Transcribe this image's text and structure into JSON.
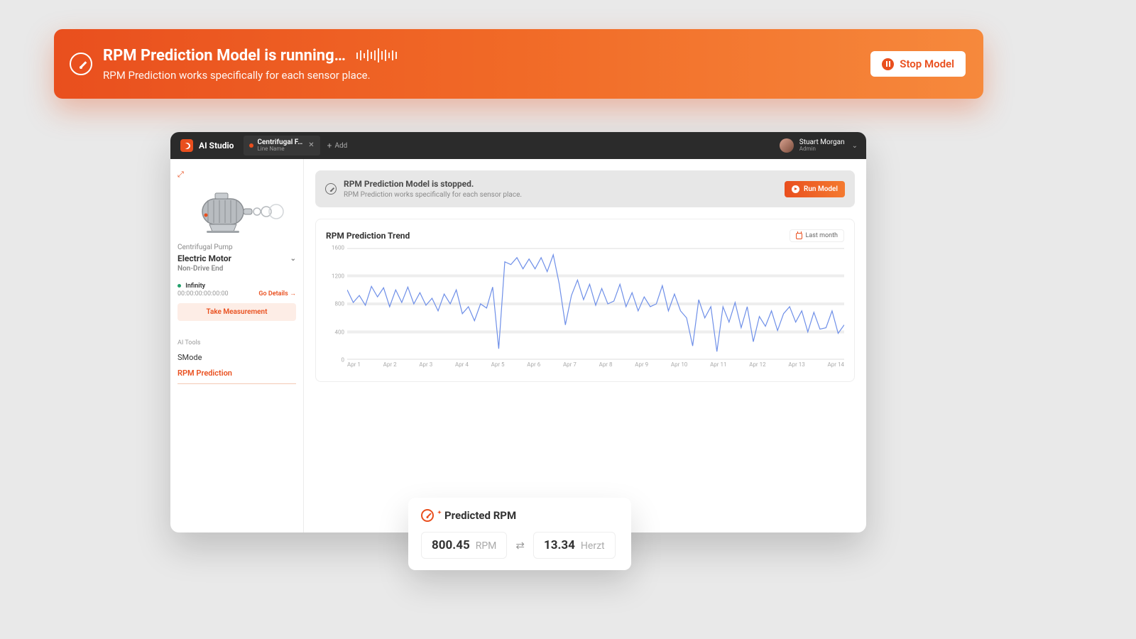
{
  "banner": {
    "title": "RPM Prediction Model is running…",
    "subtitle": "RPM Prediction works specifically for each sensor place.",
    "stop_label": "Stop Model"
  },
  "titlebar": {
    "app_name": "AI Studio",
    "tab": {
      "name": "Centrifugal F…",
      "subline": "Line Name"
    },
    "add_label": "Add",
    "user": {
      "name": "Stuart Morgan",
      "role": "Admin"
    }
  },
  "sidebar": {
    "category": "Centrifugal Pump",
    "asset": "Electric Motor",
    "position": "Non-Drive End",
    "status": "Infinity",
    "time": "00:00:00:00:00:00",
    "go_details": "Go Details →",
    "take_measurement": "Take Measurement",
    "ai_tools_label": "AI Tools",
    "tools": [
      "SMode",
      "RPM Prediction"
    ]
  },
  "stopped_banner": {
    "title": "RPM Prediction Model is stopped.",
    "subtitle": "RPM Prediction works specifically for each sensor place.",
    "run_label": "Run Model"
  },
  "chart": {
    "title": "RPM Prediction Trend",
    "range_label": "Last month"
  },
  "chart_data": {
    "type": "line",
    "title": "RPM Prediction Trend",
    "xlabel": "",
    "ylabel": "",
    "ylim": [
      0,
      1600
    ],
    "y_ticks": [
      0,
      400,
      800,
      1200,
      1600
    ],
    "x_categories": [
      "Apr 1",
      "Apr 2",
      "Apr 3",
      "Apr 4",
      "Apr 5",
      "Apr 6",
      "Apr 7",
      "Apr 8",
      "Apr 9",
      "Apr 10",
      "Apr 11",
      "Apr 12",
      "Apr 13",
      "Apr 14"
    ],
    "series": [
      {
        "name": "RPM",
        "values": [
          1000,
          820,
          920,
          780,
          1050,
          900,
          1030,
          760,
          1000,
          820,
          1040,
          800,
          960,
          780,
          880,
          700,
          940,
          800,
          1000,
          660,
          760,
          560,
          800,
          740,
          1040,
          160,
          1400,
          1360,
          1460,
          1300,
          1440,
          1300,
          1460,
          1260,
          1500,
          1080,
          500,
          920,
          1140,
          860,
          1080,
          780,
          1020,
          800,
          840,
          1080,
          760,
          960,
          700,
          900,
          760,
          800,
          1060,
          700,
          940,
          700,
          600,
          200,
          860,
          600,
          760,
          120,
          760,
          540,
          820,
          460,
          760,
          260,
          620,
          480,
          700,
          420,
          660,
          760,
          540,
          700,
          400,
          680,
          440,
          460,
          700,
          380,
          500
        ]
      }
    ]
  },
  "predicted": {
    "title": "Predicted RPM",
    "rpm_value": "800.45",
    "rpm_unit": "RPM",
    "hz_value": "13.34",
    "hz_unit": "Herzt"
  }
}
